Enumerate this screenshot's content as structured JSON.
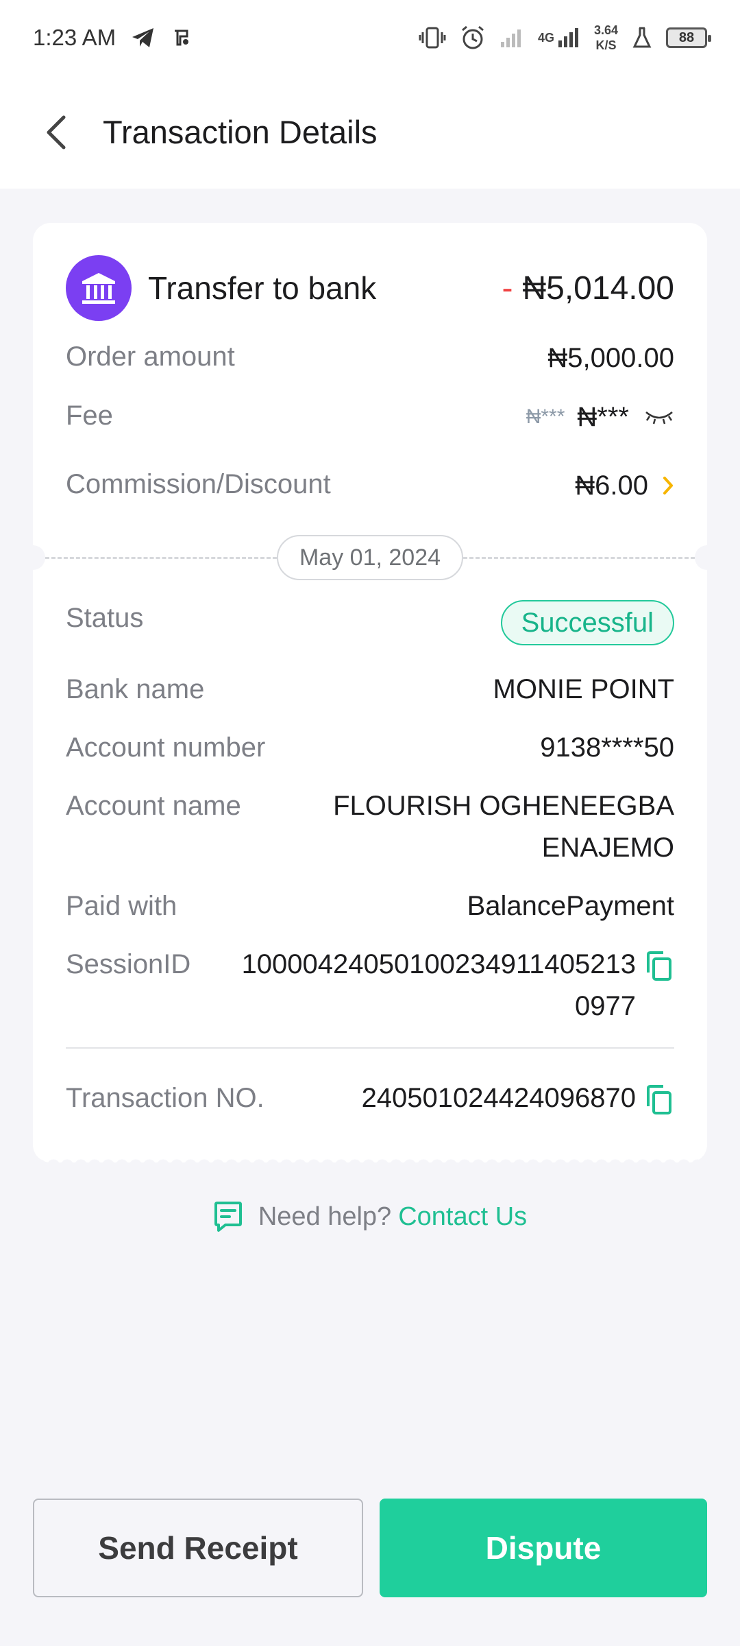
{
  "status_bar": {
    "time": "1:23 AM",
    "network": "4G",
    "speed_value": "3.64",
    "speed_unit": "K/S",
    "battery": "88"
  },
  "header": {
    "title": "Transaction Details"
  },
  "summary": {
    "type_label": "Transfer to bank",
    "amount_sign": "-",
    "amount": "₦5,014.00"
  },
  "amounts": {
    "order_amount_label": "Order amount",
    "order_amount_value": "₦5,000.00",
    "fee_label": "Fee",
    "fee_old_value": "₦***",
    "fee_value": "₦***",
    "commission_label": "Commission/Discount",
    "commission_value": "₦6.00"
  },
  "date": "May 01, 2024",
  "details": {
    "status_label": "Status",
    "status_value": "Successful",
    "bank_name_label": "Bank name",
    "bank_name_value": "MONIE POINT",
    "account_number_label": "Account number",
    "account_number_value": "9138****50",
    "account_name_label": "Account name",
    "account_name_line1": "FLOURISH OGHENEEGBA",
    "account_name_line2": "ENAJEMO",
    "paid_with_label": "Paid with",
    "paid_with_value": "BalancePayment",
    "session_id_label": "SessionID",
    "session_id_line1": "100004240501002349114052​13",
    "session_id_line2": "0977",
    "transaction_no_label": "Transaction NO.",
    "transaction_no_value": "240501024424096870"
  },
  "help": {
    "question": "Need help?",
    "link": "Contact Us"
  },
  "buttons": {
    "send_receipt": "Send Receipt",
    "dispute": "Dispute"
  },
  "colors": {
    "accent": "#1fcf9c",
    "bank_icon_bg": "#7b3ff2",
    "commission": "#f7b500",
    "minus": "#f04040"
  }
}
